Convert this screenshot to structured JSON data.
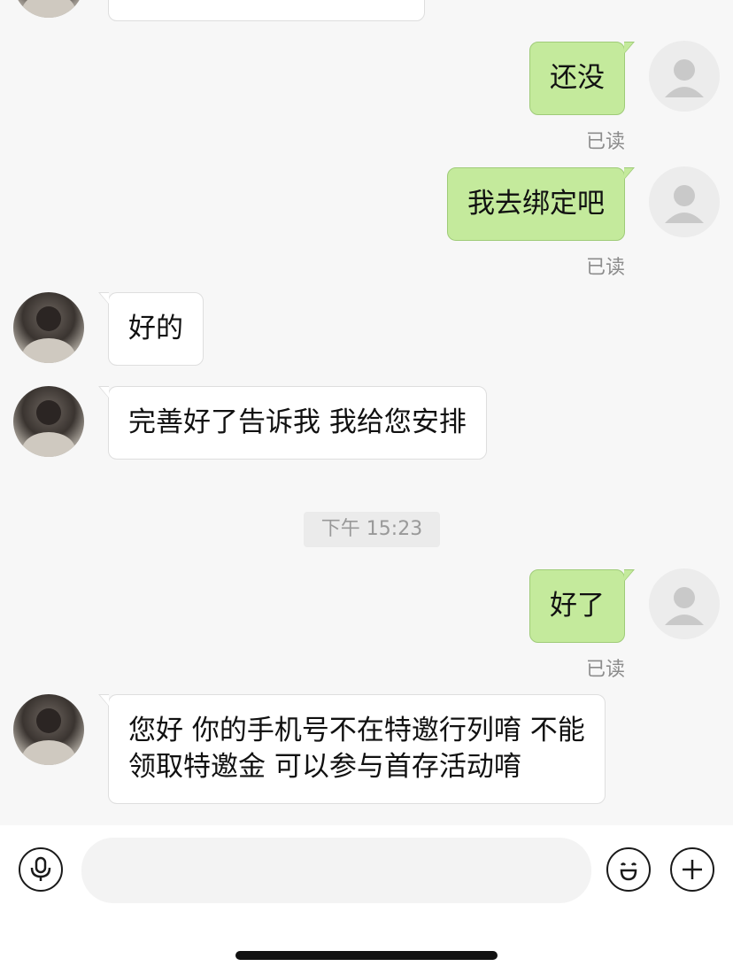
{
  "messages": [
    {
      "id": "m1",
      "side": "out",
      "text": "还没",
      "read": "已读"
    },
    {
      "id": "m2",
      "side": "out",
      "text": "我去绑定吧",
      "read": "已读"
    },
    {
      "id": "m3",
      "side": "in",
      "text": "好的"
    },
    {
      "id": "m4",
      "side": "in",
      "text": "完善好了告诉我 我给您安排"
    },
    {
      "id": "m5",
      "side": "out",
      "text": "好了",
      "read": "已读"
    },
    {
      "id": "m6",
      "side": "in",
      "line1": "您好 你的手机号不在特邀行列唷 不能",
      "line2": "领取特邀金  可以参与首存活动唷"
    }
  ],
  "timestamp": "下午 15:23",
  "input": {
    "placeholder": "",
    "voice_icon": "microphone-icon",
    "emoji_icon": "smiley-icon",
    "more_icon": "plus-icon"
  },
  "colors": {
    "background": "#f7f7f7",
    "outgoing_bubble": "#c4ea9c",
    "incoming_bubble": "#ffffff",
    "read_text": "#8c8c8c"
  }
}
